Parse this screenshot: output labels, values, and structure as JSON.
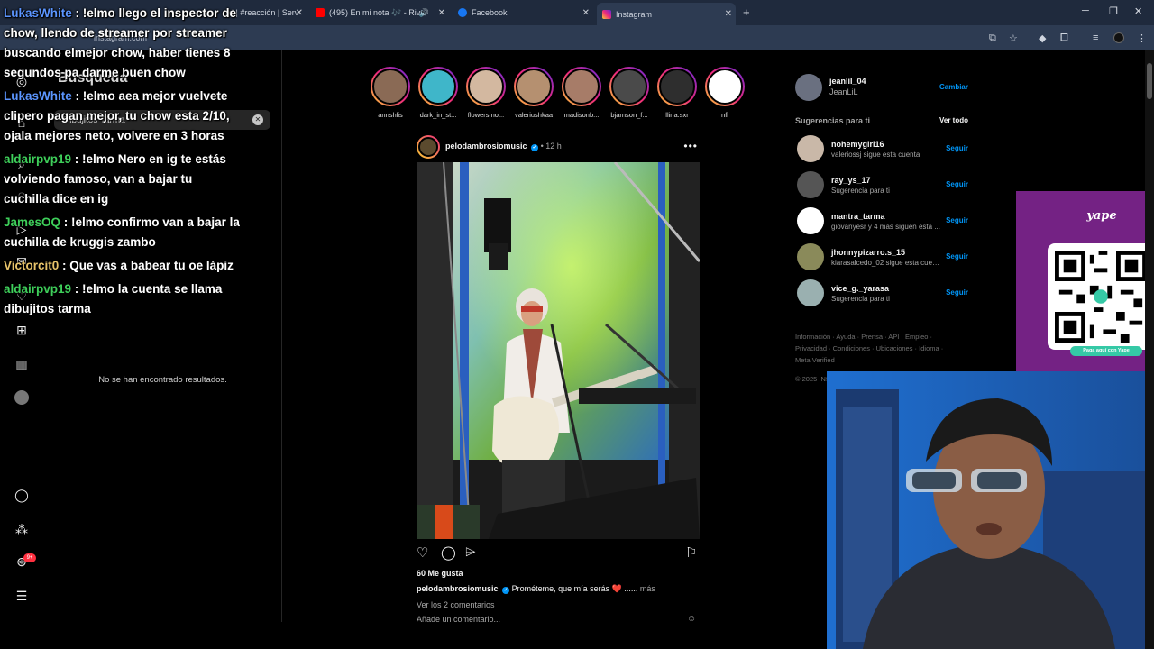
{
  "browser": {
    "tabs": [
      {
        "label": "d | #reacción | Serv",
        "icon_color": "#e9e9e9"
      },
      {
        "label": "(495) En mi nota 🎶 - Rivn",
        "icon_color": "#ff0000"
      },
      {
        "label": "Facebook",
        "icon_color": "#1877f2"
      },
      {
        "label": "Instagram",
        "icon_color": "#e1306c"
      }
    ],
    "new_tab": "+",
    "address": "instagram.com",
    "window_controls": [
      "─",
      "❐",
      "✕"
    ],
    "close": "✕"
  },
  "search_panel": {
    "title": "Búsqueda",
    "query": "Dibujitos Tarma",
    "clear": "✕",
    "no_results": "No se han encontrado resultados."
  },
  "chat": [
    {
      "user": "LukasWhite",
      "color": "#5b95ff",
      "text": "!elmo llego el inspector de chow, llendo de streamer por streamer buscando elmejor chow, haber tienes 8 segundos pa darme buen chow"
    },
    {
      "user": "LukasWhite",
      "color": "#5b95ff",
      "text": "!elmo aea mejor vuelvete clipero pagan mejor, tu chow esta 2/10, ojala mejores neto, volvere en 3 horas"
    },
    {
      "user": "aldairpvp19",
      "color": "#3ecf5a",
      "text": "!elmo Nero en ig te estás volviendo famoso, van a bajar tu cuchilla dice en ig"
    },
    {
      "user": "JamesOQ",
      "color": "#3ecf5a",
      "text": "!elmo confirmo van a bajar la cuchilla de kruggis zambo"
    },
    {
      "user": "Victorcit0",
      "color": "#e8c46a",
      "text": "Que vas a babear tu oe lápiz"
    },
    {
      "user": "aldairpvp19",
      "color": "#3ecf5a",
      "text": "!elmo la cuenta se llama dibujitos tarma"
    }
  ],
  "rail": {
    "badge": "9+"
  },
  "stories": [
    {
      "name": "annshlis",
      "seen": false,
      "color": "#8a6a55"
    },
    {
      "name": "dark_in_st...",
      "seen": false,
      "color": "#3fb6c9"
    },
    {
      "name": "flowers.no...",
      "seen": false,
      "color": "#d3b8a0"
    },
    {
      "name": "valeriushkaa",
      "seen": false,
      "color": "#b59070"
    },
    {
      "name": "madisonb...",
      "seen": false,
      "color": "#a77c68"
    },
    {
      "name": "bjarnson_f...",
      "seen": false,
      "color": "#4a4a4a"
    },
    {
      "name": "llina.sxr",
      "seen": false,
      "color": "#2e2e2e"
    },
    {
      "name": "nfl",
      "seen": false,
      "color": "#ffffff"
    }
  ],
  "post": {
    "user": "pelodambrosiomusic",
    "verified": "✓",
    "time": "12 h",
    "more": "•••",
    "likes": "60 Me gusta",
    "caption_user": "pelodambrosiomusic",
    "caption_text": "Prométeme, que mía serás ❤️ ......",
    "caption_more": "más",
    "comments_link": "Ver los 2 comentarios",
    "add_comment": "Añade un comentario..."
  },
  "sidebar": {
    "me": {
      "username": "jeanlil_04",
      "name": "JeanLiL",
      "switch": "Cambiar"
    },
    "suggestions_title": "Sugerencias para ti",
    "see_all": "Ver todo",
    "suggestions": [
      {
        "username": "nohemygirl16",
        "sub": "valeriossj sigue esta cuenta",
        "follow": "Seguir",
        "color": "#c9b8a8"
      },
      {
        "username": "ray_ys_17",
        "sub": "Sugerencia para ti",
        "follow": "Seguir",
        "color": "#555555"
      },
      {
        "username": "mantra_tarma",
        "sub": "giovanyesr y 4 más siguen esta ...",
        "follow": "Seguir",
        "color": "#ffffff"
      },
      {
        "username": "jhonnypizarro.s_15",
        "sub": "kiarasalcedo_02 sigue esta cuenta",
        "follow": "Seguir",
        "color": "#8a8a5a"
      },
      {
        "username": "vice_g._yarasa",
        "sub": "Sugerencia para ti",
        "follow": "Seguir",
        "color": "#9ab0b0"
      }
    ],
    "footer_links": "Información · Ayuda · Prensa · API · Empleo · Privacidad · Condiciones · Ubicaciones · Idioma · Meta Verified",
    "copyright": "© 2025 INSTAGRAM FROM META"
  },
  "yape": {
    "logo": "yape",
    "pay_label": "Paga aquí con Yape"
  }
}
